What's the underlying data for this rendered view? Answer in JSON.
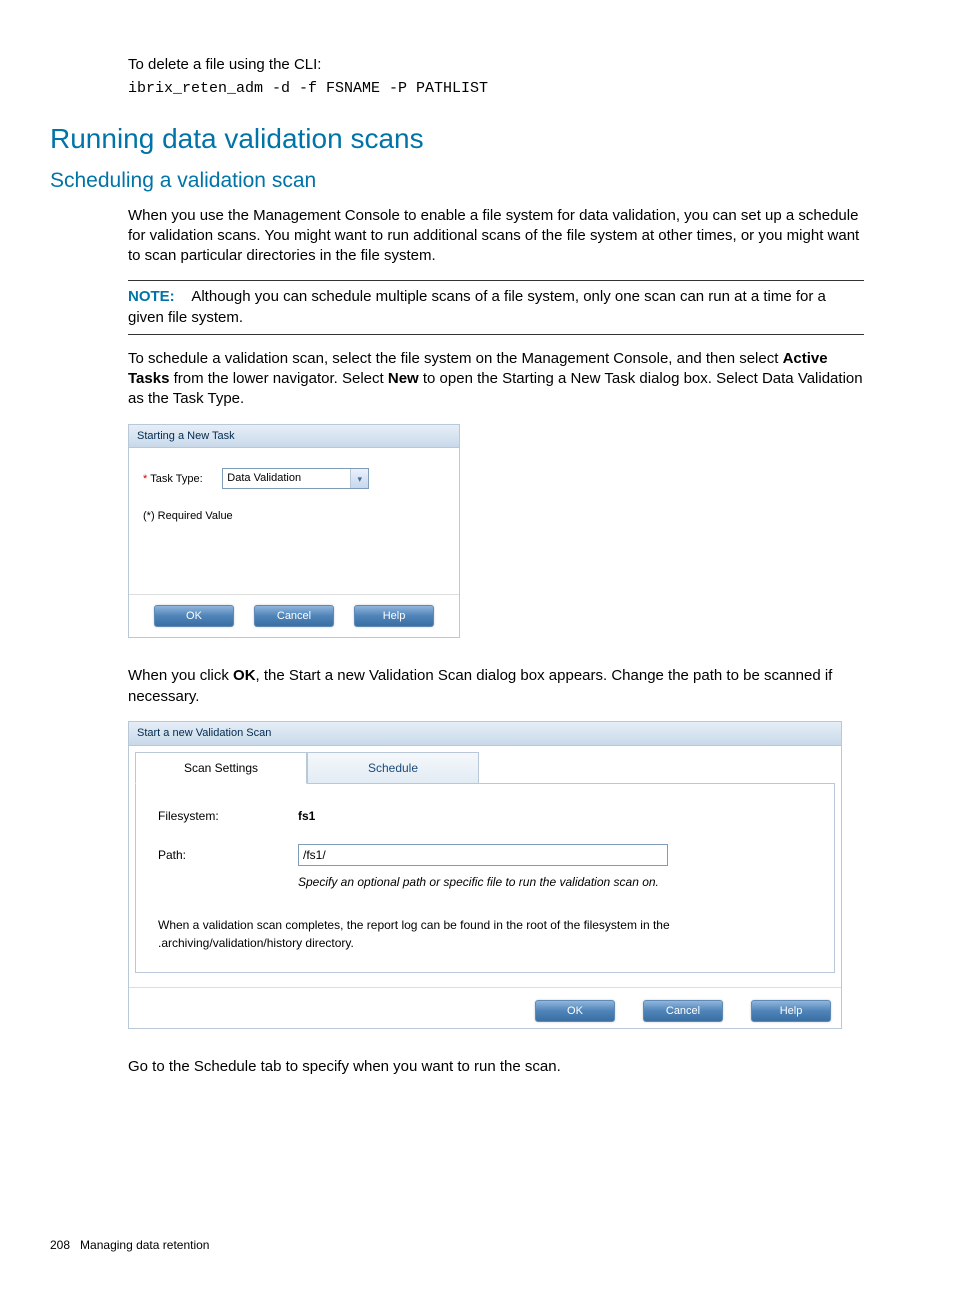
{
  "intro": {
    "delete_text": "To delete a file using the CLI:",
    "cli": "ibrix_reten_adm -d -f FSNAME -P PATHLIST"
  },
  "h1": "Running data validation scans",
  "h2": "Scheduling a validation scan",
  "para1": "When you use the Management Console to enable a file system for data validation, you can set up a schedule for validation scans. You might want to run additional scans of the file system at other times, or you might want to scan particular directories in the file system.",
  "note": {
    "label": "NOTE:",
    "text": "Although you can schedule multiple scans of a file system, only one scan can run at a time for a given file system."
  },
  "para2_a": "To schedule a validation scan, select the file system on the Management Console, and then select ",
  "para2_b": "Active Tasks",
  "para2_c": " from the lower navigator. Select ",
  "para2_d": "New",
  "para2_e": " to open the Starting a New Task dialog box. Select Data Validation as the Task Type.",
  "dialog1": {
    "title": "Starting a New Task",
    "task_type_label": "Task Type:",
    "task_type_value": "Data Validation",
    "required_text": "(*) Required Value",
    "ok": "OK",
    "cancel": "Cancel",
    "help": "Help"
  },
  "para3_a": "When you click ",
  "para3_b": "OK",
  "para3_c": ", the Start a new Validation Scan dialog box appears. Change the path to be scanned if necessary.",
  "dialog2": {
    "title": "Start a new Validation Scan",
    "tab1": "Scan Settings",
    "tab2": "Schedule",
    "filesystem_label": "Filesystem:",
    "filesystem_value": "fs1",
    "path_label": "Path:",
    "path_value": "/fs1/",
    "path_hint": "Specify an optional path or specific file to run the validation scan on.",
    "completion_note": "When a validation scan completes, the report log can be found in the root of the filesystem in the .archiving/validation/history directory.",
    "ok": "OK",
    "cancel": "Cancel",
    "help": "Help"
  },
  "para4": "Go to the Schedule tab to specify when you want to run the scan.",
  "footer": {
    "page": "208",
    "section": "Managing data retention"
  }
}
